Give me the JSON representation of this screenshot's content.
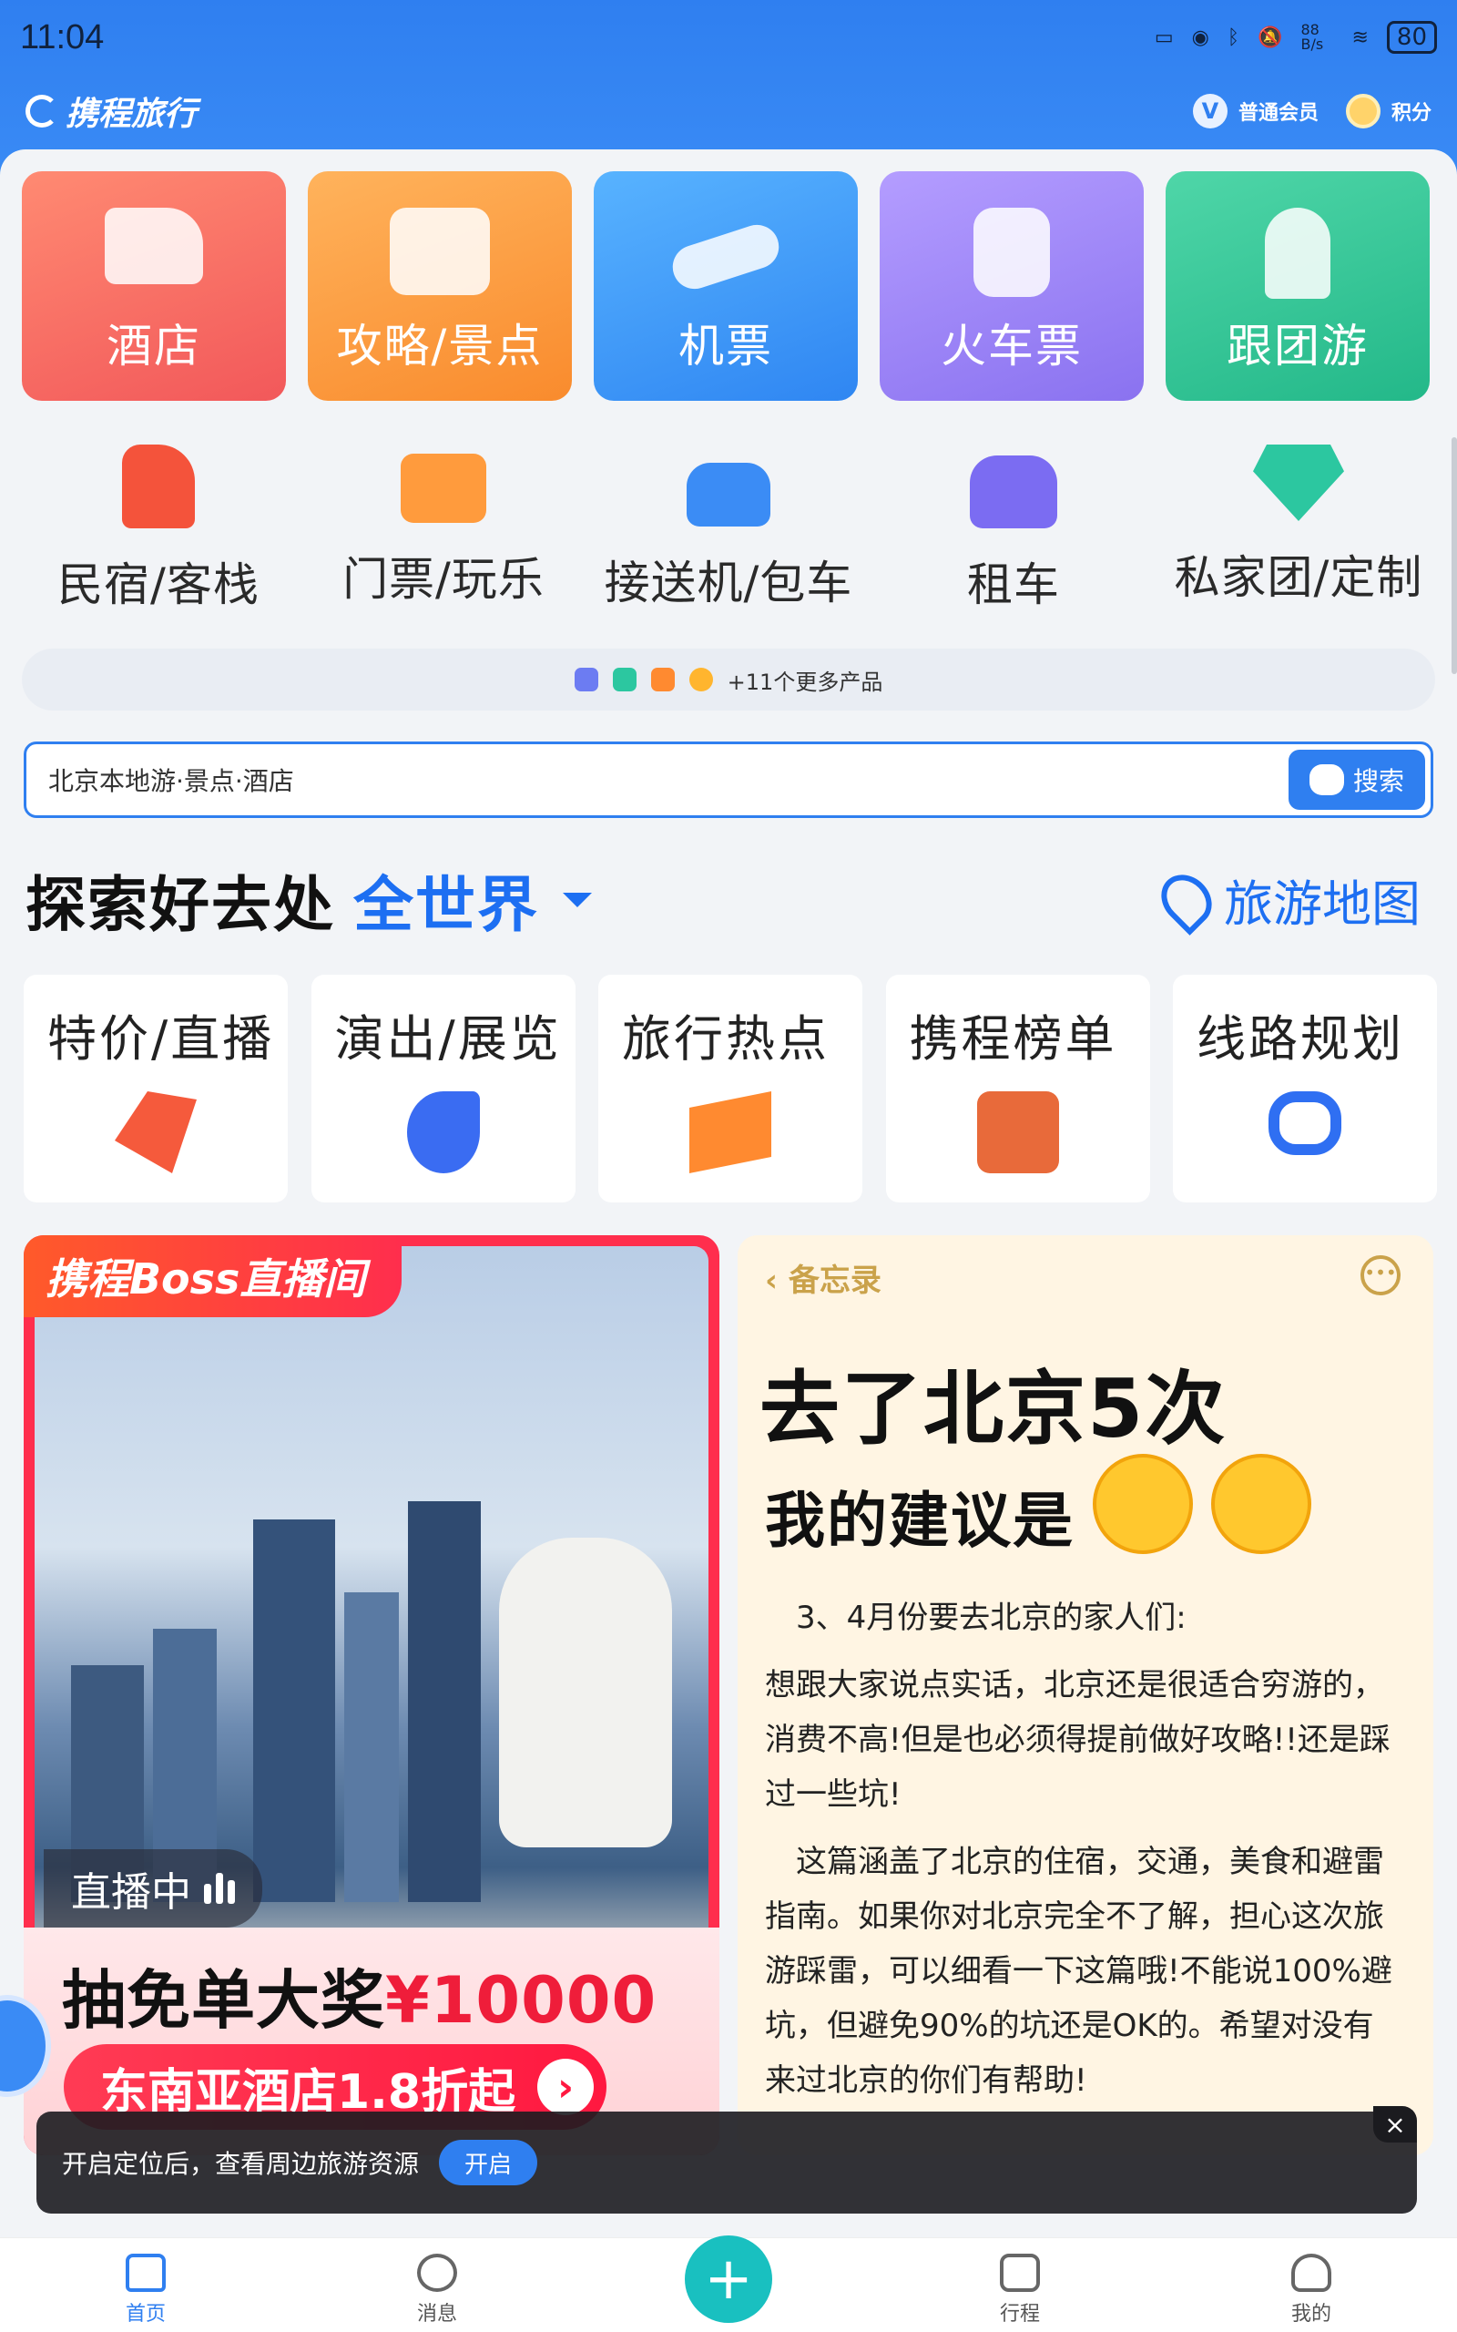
{
  "status_bar": {
    "time": "11:04",
    "net_speed": "88 B/s",
    "battery": "80"
  },
  "header": {
    "app_name": "携程旅行",
    "member_label": "普通会员",
    "member_badge": "V",
    "points_label": "积分"
  },
  "main_tiles": [
    {
      "label": "酒店",
      "icon": "hotel-icon"
    },
    {
      "label": "攻略/景点",
      "icon": "guide-book-icon"
    },
    {
      "label": "机票",
      "icon": "airplane-icon"
    },
    {
      "label": "火车票",
      "icon": "train-icon"
    },
    {
      "label": "跟团游",
      "icon": "palm-tree-icon"
    }
  ],
  "sub_entries": [
    {
      "label": "民宿/客栈",
      "icon": "homestay-icon"
    },
    {
      "label": "门票/玩乐",
      "icon": "ticket-icon"
    },
    {
      "label": "接送机/包车",
      "icon": "airport-car-icon"
    },
    {
      "label": "租车",
      "icon": "car-icon"
    },
    {
      "label": "私家团/定制",
      "icon": "diamond-icon"
    }
  ],
  "more_products": {
    "text": "+11个更多产品",
    "colors": [
      "#6c7cf2",
      "#2cc7a0",
      "#ff8a30",
      "#ffb52e"
    ]
  },
  "search": {
    "placeholder": "北京本地游·景点·酒店",
    "button_label": "搜索"
  },
  "explore": {
    "title": "探索好去处",
    "region": "全世界",
    "map_label": "旅游地图"
  },
  "categories": [
    {
      "label": "特价/直播",
      "icon": "price-tag-icon"
    },
    {
      "label": "演出/展览",
      "icon": "music-note-icon"
    },
    {
      "label": "旅行热点",
      "icon": "hot-flag-icon"
    },
    {
      "label": "携程榜单",
      "icon": "ranking-icon"
    },
    {
      "label": "线路规划",
      "icon": "route-icon"
    }
  ],
  "live_card": {
    "tag": "携程Boss直播间",
    "live_status": "直播中",
    "headline_prefix": "抽免单大奖",
    "headline_amount": "¥10000",
    "promo": "东南亚酒店1.8折起"
  },
  "memo_card": {
    "header": "备忘录",
    "title_line1": "去了北京5次",
    "title_line2": "我的建议是",
    "paragraphs": [
      "3、4月份要去北京的家人们:",
      "想跟大家说点实话，北京还是很适合穷游的，消费不高!但是也必须得提前做好攻略!!还是踩过一些坑!",
      "这篇涵盖了北京的住宿，交通，美食和避雷指南。如果你对北京完全不了解，担心这次旅游踩雷，可以细看一下这篇哦!不能说100%避坑，但避免90%的坑还是OK的。希望对没有来过北京的你们有帮助!"
    ]
  },
  "toast": {
    "message": "开启定位后，查看周边旅游资源",
    "button": "开启",
    "close": "×"
  },
  "tabbar": [
    {
      "label": "首页",
      "icon": "home-icon"
    },
    {
      "label": "消息",
      "icon": "message-icon"
    },
    {
      "label": "",
      "icon": "plus-icon"
    },
    {
      "label": "行程",
      "icon": "itinerary-icon"
    },
    {
      "label": "我的",
      "icon": "profile-icon"
    }
  ]
}
